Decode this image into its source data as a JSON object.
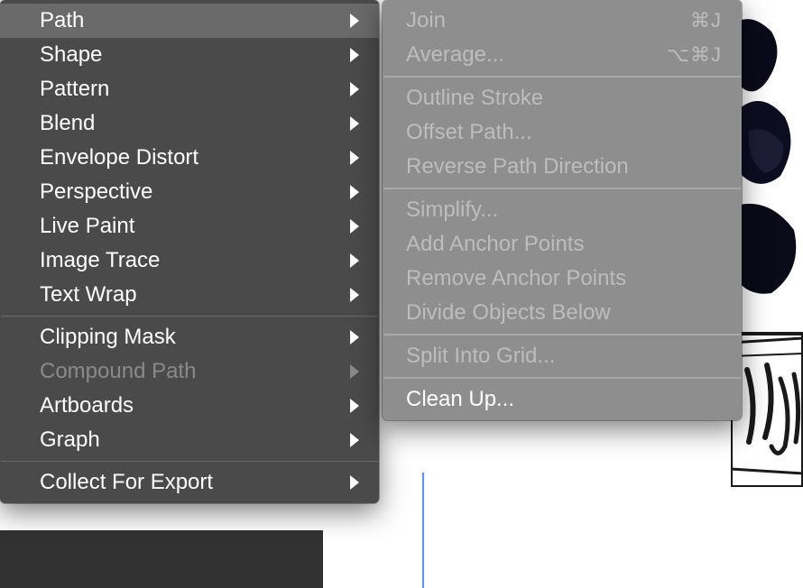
{
  "main_menu": {
    "groups": [
      [
        {
          "label": "Path",
          "submenu": true,
          "highlighted": true,
          "disabled": false
        },
        {
          "label": "Shape",
          "submenu": true,
          "highlighted": false,
          "disabled": false
        },
        {
          "label": "Pattern",
          "submenu": true,
          "highlighted": false,
          "disabled": false
        },
        {
          "label": "Blend",
          "submenu": true,
          "highlighted": false,
          "disabled": false
        },
        {
          "label": "Envelope Distort",
          "submenu": true,
          "highlighted": false,
          "disabled": false
        },
        {
          "label": "Perspective",
          "submenu": true,
          "highlighted": false,
          "disabled": false
        },
        {
          "label": "Live Paint",
          "submenu": true,
          "highlighted": false,
          "disabled": false
        },
        {
          "label": "Image Trace",
          "submenu": true,
          "highlighted": false,
          "disabled": false
        },
        {
          "label": "Text Wrap",
          "submenu": true,
          "highlighted": false,
          "disabled": false
        }
      ],
      [
        {
          "label": "Clipping Mask",
          "submenu": true,
          "highlighted": false,
          "disabled": false
        },
        {
          "label": "Compound Path",
          "submenu": true,
          "highlighted": false,
          "disabled": true
        },
        {
          "label": "Artboards",
          "submenu": true,
          "highlighted": false,
          "disabled": false
        },
        {
          "label": "Graph",
          "submenu": true,
          "highlighted": false,
          "disabled": false
        }
      ],
      [
        {
          "label": "Collect For Export",
          "submenu": true,
          "highlighted": false,
          "disabled": false
        }
      ]
    ]
  },
  "sub_menu": {
    "groups": [
      [
        {
          "label": "Join",
          "shortcut": "⌘J",
          "disabled": true
        },
        {
          "label": "Average...",
          "shortcut": "⌥⌘J",
          "disabled": true
        }
      ],
      [
        {
          "label": "Outline Stroke",
          "shortcut": "",
          "disabled": true
        },
        {
          "label": "Offset Path...",
          "shortcut": "",
          "disabled": true
        },
        {
          "label": "Reverse Path Direction",
          "shortcut": "",
          "disabled": true
        }
      ],
      [
        {
          "label": "Simplify...",
          "shortcut": "",
          "disabled": true
        },
        {
          "label": "Add Anchor Points",
          "shortcut": "",
          "disabled": true
        },
        {
          "label": "Remove Anchor Points",
          "shortcut": "",
          "disabled": true
        },
        {
          "label": "Divide Objects Below",
          "shortcut": "",
          "disabled": true
        }
      ],
      [
        {
          "label": "Split Into Grid...",
          "shortcut": "",
          "disabled": true
        }
      ],
      [
        {
          "label": "Clean Up...",
          "shortcut": "",
          "disabled": false,
          "active": true
        }
      ]
    ]
  }
}
